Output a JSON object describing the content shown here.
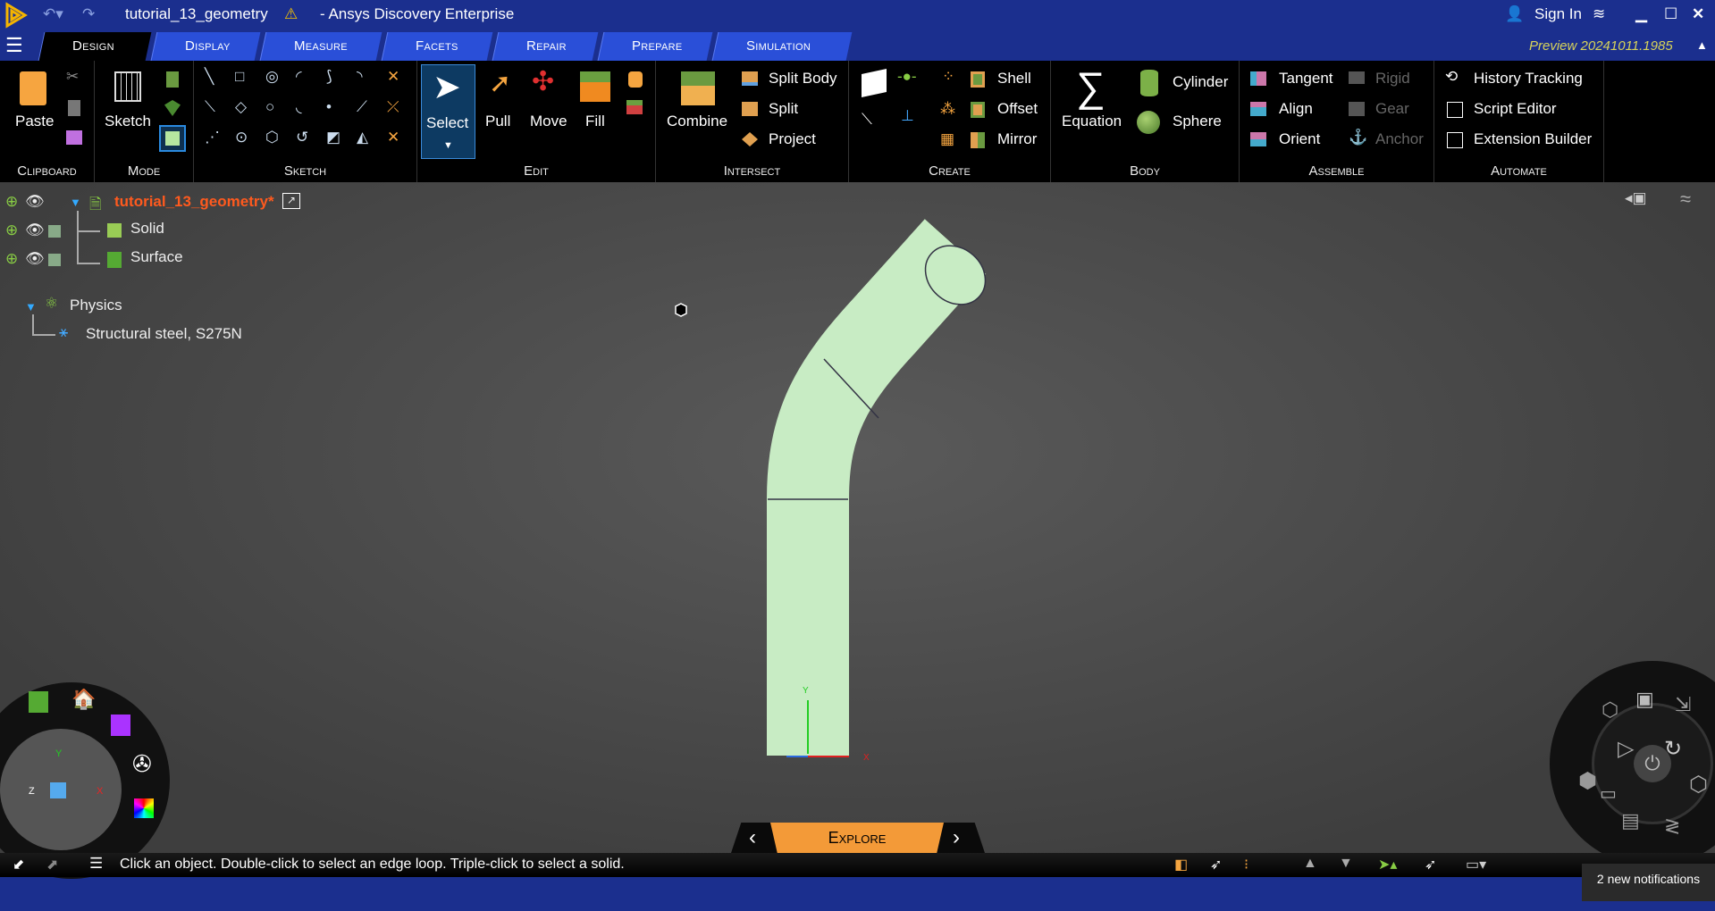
{
  "title": {
    "file": "tutorial_13_geometry",
    "app": "- Ansys Discovery Enterprise",
    "sign_in": "Sign In",
    "preview": "Preview 20241011.1985"
  },
  "tabs": [
    {
      "label": "Design"
    },
    {
      "label": "Display"
    },
    {
      "label": "Measure"
    },
    {
      "label": "Facets"
    },
    {
      "label": "Repair"
    },
    {
      "label": "Prepare"
    },
    {
      "label": "Simulation"
    }
  ],
  "ribbon": {
    "clipboard": {
      "label": "Clipboard",
      "paste": "Paste"
    },
    "mode": {
      "label": "Mode",
      "sketch": "Sketch"
    },
    "sketch": {
      "label": "Sketch"
    },
    "edit": {
      "label": "Edit",
      "select": "Select",
      "pull": "Pull",
      "move": "Move",
      "fill": "Fill"
    },
    "intersect": {
      "label": "Intersect",
      "combine": "Combine",
      "split_body": "Split Body",
      "split": "Split",
      "project": "Project"
    },
    "create": {
      "label": "Create",
      "shell": "Shell",
      "offset": "Offset",
      "mirror": "Mirror"
    },
    "body": {
      "label": "Body",
      "equation": "Equation",
      "cylinder": "Cylinder",
      "sphere": "Sphere"
    },
    "assemble": {
      "label": "Assemble",
      "tangent": "Tangent",
      "align": "Align",
      "orient": "Orient",
      "rigid": "Rigid",
      "gear": "Gear",
      "anchor": "Anchor"
    },
    "automate": {
      "label": "Automate",
      "history": "History Tracking",
      "script": "Script Editor",
      "extension": "Extension Builder"
    }
  },
  "tree": {
    "root": "tutorial_13_geometry*",
    "solid": "Solid",
    "surface": "Surface",
    "physics": "Physics",
    "material": "Structural steel, S275N"
  },
  "viewport": {
    "explore": "Explore",
    "axis_x": "X",
    "axis_y": "Y",
    "axis_z": "Z"
  },
  "status": {
    "message": "Click an object. Double-click to select an edge loop. Triple-click to select a solid.",
    "notifications": "2 new notifications"
  },
  "colors": {
    "accent": "#f39a38",
    "titlebar": "#1b2f8e",
    "tab": "#2a4fd8",
    "pipe": "#c8ecc4"
  }
}
